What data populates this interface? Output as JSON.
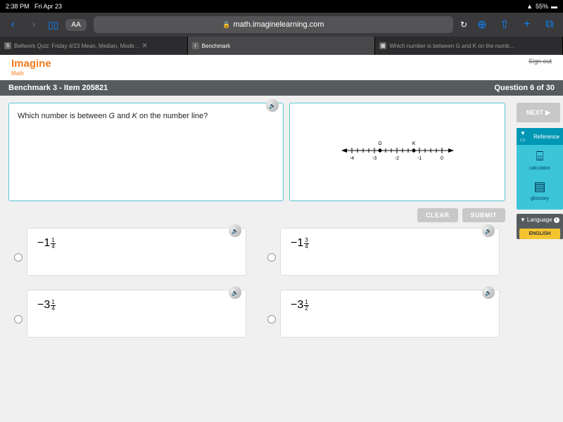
{
  "status": {
    "time": "2:38 PM",
    "date": "Fri Apr 23",
    "wifi": "᯾",
    "battery_pct": "55%",
    "battery_icon": "▮"
  },
  "browser": {
    "aa": "AA",
    "url": "math.imaginelearning.com",
    "tabs": [
      {
        "icon": "S",
        "label": "Bellwork Quiz: Friday 4/23 Mean, Median, Mode..."
      },
      {
        "icon": "I",
        "label": "Benchmark"
      },
      {
        "icon": "▦",
        "label": "Which number is between G and K on the numb..."
      }
    ]
  },
  "brand": {
    "name": "Imagine",
    "sub": "Math",
    "signout": "Sign out"
  },
  "header": {
    "left": "Benchmark 3 - Item 205821",
    "right": "Question 6 of 30"
  },
  "question": {
    "text_pre": "Which number is between ",
    "g": "G",
    "mid": " and ",
    "k": "K",
    "text_post": " on the number line?"
  },
  "diagram": {
    "g_label": "G",
    "k_label": "K",
    "ticks": [
      "-4",
      "-3",
      "-2",
      "-1",
      "0"
    ]
  },
  "buttons": {
    "clear": "CLEAR",
    "submit": "SUBMIT",
    "next": "NEXT"
  },
  "answers": [
    {
      "neg": "−",
      "whole": "1",
      "num": "1",
      "den": "4"
    },
    {
      "neg": "−",
      "whole": "1",
      "num": "3",
      "den": "4"
    },
    {
      "neg": "−",
      "whole": "3",
      "num": "1",
      "den": "4"
    },
    {
      "neg": "−",
      "whole": "3",
      "num": "1",
      "den": "2"
    }
  ],
  "reference": {
    "title": "Reference",
    "calc": "calculator",
    "glossary": "glossary"
  },
  "language": {
    "title": "Language",
    "english": "ENGLISH"
  }
}
